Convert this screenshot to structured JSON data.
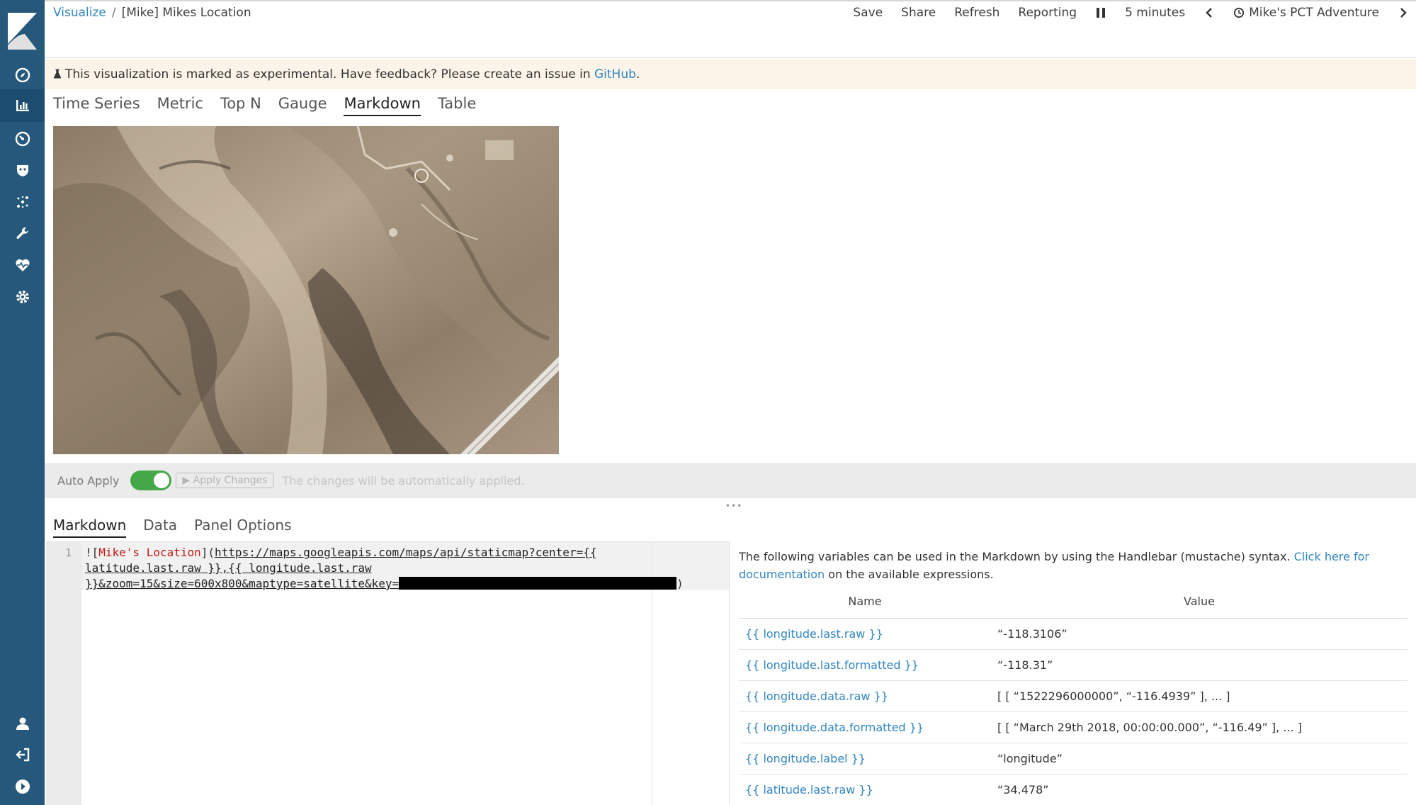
{
  "sidebar": {
    "logo": "kibana-logo",
    "items": [
      {
        "name": "discover-icon"
      },
      {
        "name": "visualize-icon",
        "active": true
      },
      {
        "name": "dashboard-icon"
      },
      {
        "name": "timelion-icon"
      },
      {
        "name": "ml-icon"
      },
      {
        "name": "dev-tools-icon"
      },
      {
        "name": "monitoring-icon"
      },
      {
        "name": "management-icon"
      }
    ],
    "bottom_items": [
      {
        "name": "user-icon"
      },
      {
        "name": "logout-icon"
      },
      {
        "name": "collapse-icon"
      }
    ]
  },
  "header": {
    "breadcrumb_root": "Visualize",
    "breadcrumb_sep": "/",
    "breadcrumb_current": "[Mike] Mikes Location",
    "save": "Save",
    "share": "Share",
    "refresh": "Refresh",
    "reporting": "Reporting",
    "interval": "5 minutes",
    "time_label": "Mike's PCT Adventure"
  },
  "banner": {
    "text": "This visualization is marked as experimental. Have feedback? Please create an issue in",
    "link": "GitHub",
    "suffix": "."
  },
  "vis_tabs": [
    "Time Series",
    "Metric",
    "Top N",
    "Gauge",
    "Markdown",
    "Table"
  ],
  "vis_tab_active": "Markdown",
  "apply_bar": {
    "label": "Auto Apply",
    "toggle_on": true,
    "button": "Apply Changes",
    "note": "The changes will be automatically applied."
  },
  "editor_tabs": [
    "Markdown",
    "Data",
    "Panel Options"
  ],
  "editor": {
    "line_number": "1",
    "prefix": "![",
    "alt_text": "Mike's Location",
    "mid": "](",
    "url_part1": "https://maps.googleapis.com/maps/api/staticmap?center={{",
    "url_part2": "latitude.last.raw }},{{ longitude.last.raw",
    "url_part3": "}}&zoom=15&size=600x800&maptype=satellite&key=",
    "suffix": ")"
  },
  "variables": {
    "intro": "The following variables can be used in the Markdown by using the Handlebar (mustache) syntax.",
    "link": "Click here for documentation",
    "intro_suffix": "on the available expressions.",
    "col_name": "Name",
    "col_value": "Value",
    "rows": [
      {
        "name": "{{ longitude.last.raw }}",
        "value": "“-118.3106”"
      },
      {
        "name": "{{ longitude.last.formatted }}",
        "value": "“-118.31”"
      },
      {
        "name": "{{ longitude.data.raw }}",
        "value": "[ [ “1522296000000”, “-116.4939” ], ... ]"
      },
      {
        "name": "{{ longitude.data.formatted }}",
        "value": "[ [ “March 29th 2018, 00:00:00.000”, “-116.49” ], ... ]"
      },
      {
        "name": "{{ longitude.label }}",
        "value": "“longitude”"
      },
      {
        "name": "{{ latitude.last.raw }}",
        "value": "“34.478”"
      }
    ]
  },
  "colors": {
    "sidebar": "#25587a",
    "link": "#3185bf",
    "toggle": "#44a848",
    "banner": "#fcf4e8"
  }
}
